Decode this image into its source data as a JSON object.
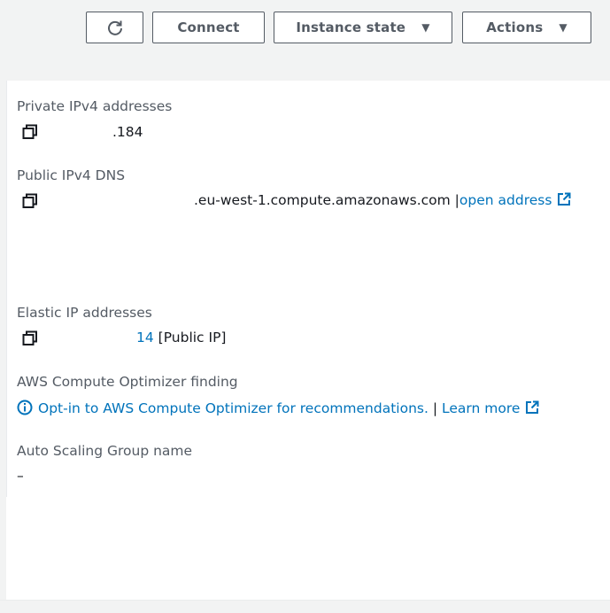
{
  "toolbar": {
    "refresh_icon": "refresh-icon",
    "connect_label": "Connect",
    "instance_state_label": "Instance state",
    "actions_label": "Actions"
  },
  "details": {
    "private_ipv4": {
      "label": "Private IPv4 addresses",
      "value": ".184"
    },
    "public_dns": {
      "label": "Public IPv4 DNS",
      "value": ".eu-west-1.compute.amazonaws.com |",
      "open_link": "open address"
    },
    "elastic_ip": {
      "label": "Elastic IP addresses",
      "value": "14",
      "suffix": " [Public IP]"
    },
    "optimizer": {
      "label": "AWS Compute Optimizer finding",
      "opt_in_link": "Opt-in to AWS Compute Optimizer for recommendations.",
      "separator": " | ",
      "learn_more": "Learn more"
    },
    "asg": {
      "label": "Auto Scaling Group name",
      "value": "–"
    }
  },
  "colors": {
    "link": "#0073bb",
    "label": "#545b64",
    "text": "#16191f"
  }
}
